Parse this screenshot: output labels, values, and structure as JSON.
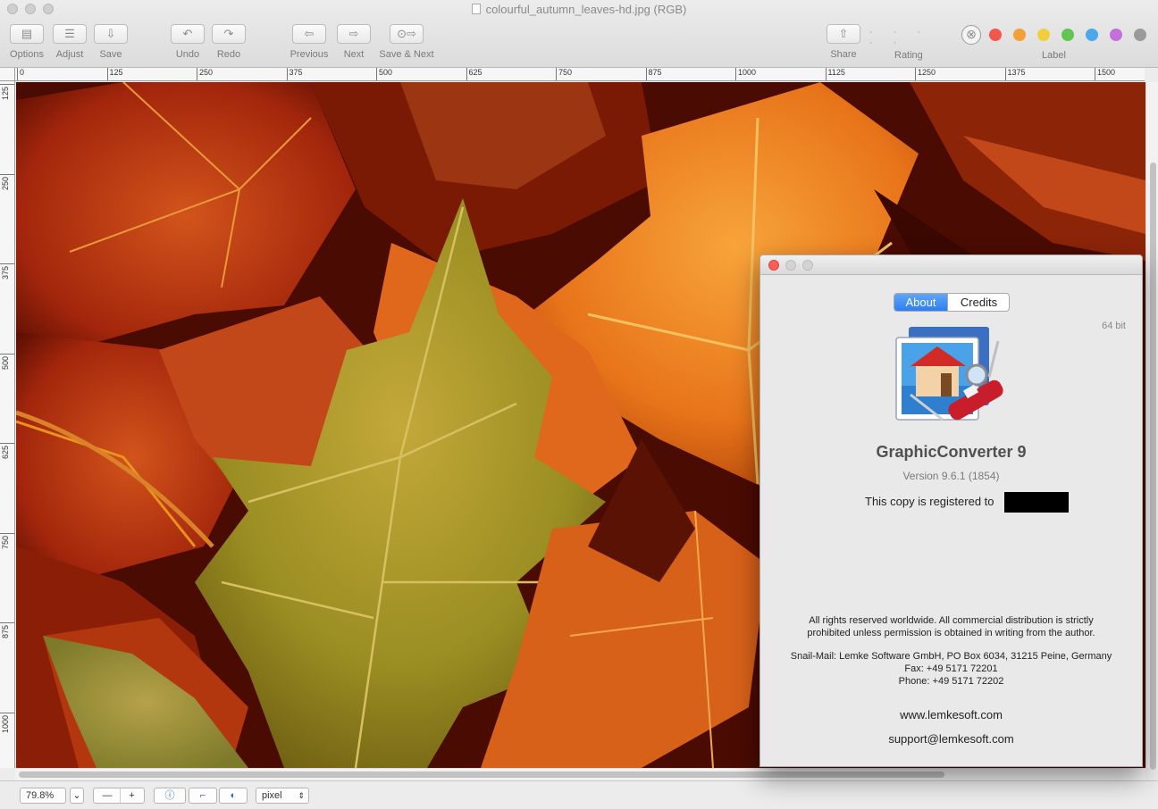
{
  "window": {
    "title": "colourful_autumn_leaves-hd.jpg (RGB)"
  },
  "toolbar": {
    "options": "Options",
    "adjust": "Adjust",
    "save": "Save",
    "undo": "Undo",
    "redo": "Redo",
    "previous": "Previous",
    "next": "Next",
    "save_next": "Save & Next",
    "share": "Share",
    "rating": "Rating",
    "rating_stars": "· · · · ·",
    "label": "Label",
    "label_colors": [
      "#f2574e",
      "#f4a036",
      "#f2cd3c",
      "#5fc751",
      "#4aa8ed",
      "#c46fdc",
      "#9a9a9a"
    ]
  },
  "rulers": {
    "horizontal": [
      "0",
      "125",
      "250",
      "375",
      "500",
      "625",
      "750",
      "875",
      "1000",
      "1125",
      "1250",
      "1375",
      "1500"
    ],
    "vertical": [
      "125",
      "250",
      "375",
      "500",
      "625",
      "750",
      "875",
      "1000"
    ]
  },
  "bottom": {
    "zoom": "79.8%",
    "unit": "pixel",
    "minus": "—",
    "plus": "+",
    "info_icon": "ⓘ"
  },
  "about": {
    "tab_about": "About",
    "tab_credits": "Credits",
    "bits": "64 bit",
    "app_name": "GraphicConverter 9",
    "version": "Version 9.6.1 (1854)",
    "registered": "This copy is registered to",
    "rights_line1": "All rights reserved worldwide. All commercial distribution is strictly",
    "rights_line2": "prohibited unless permission is obtained in writing from the author.",
    "mail": "Snail-Mail: Lemke Software GmbH, PO Box 6034, 31215 Peine, Germany",
    "fax": "Fax: +49 5171 72201",
    "phone": "Phone: +49 5171 72202",
    "website": "www.lemkesoft.com",
    "email": "support@lemkesoft.com"
  }
}
